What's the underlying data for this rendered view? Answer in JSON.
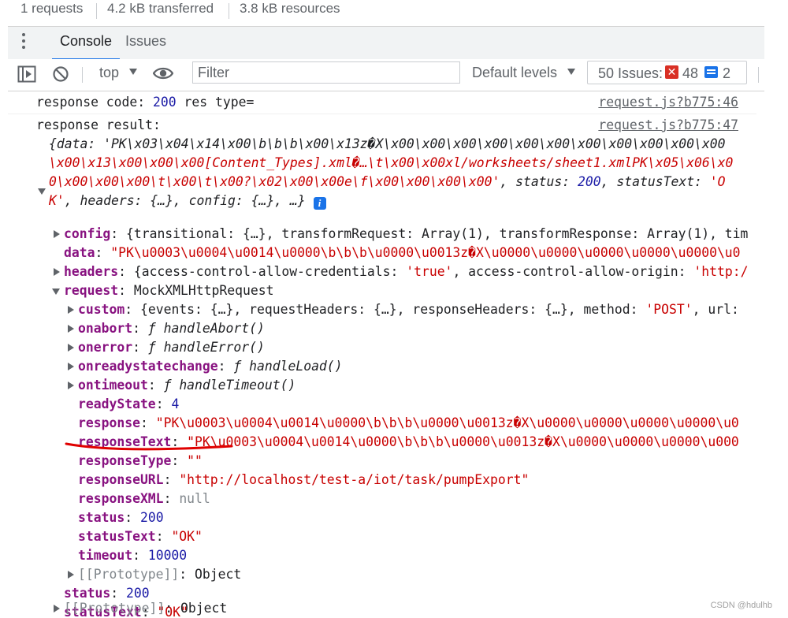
{
  "netbar": {
    "requests": "1 requests",
    "transferred": "4.2 kB transferred",
    "resources": "3.8 kB resources"
  },
  "tabs": {
    "console": "Console",
    "issues": "Issues"
  },
  "toolbar": {
    "context": "top",
    "filter_placeholder": "Filter",
    "levels": "Default levels",
    "issues_label": "50 Issues:",
    "errors_count": "48",
    "info_count": "2"
  },
  "console": {
    "msg1": {
      "text": "response code: ",
      "code": "200",
      "tail": "  res type=",
      "source": "request.js?b775:46"
    },
    "msg2": {
      "text": "response result:",
      "source": "request.js?b775:47",
      "summary_line1": "{data: 'PK\\x03\\x04\\x14\\x00\\b\\b\\b\\x00\\x13z�X\\x00\\x00\\x00\\x00\\x00\\x00\\x00\\x00\\x00\\x00\\x00",
      "summary_line2": "\\x00\\x13\\x00\\x00\\x00[Content_Types].xml�…\\t\\x00\\x00xl/worksheets/sheet1.xmlPK\\x05\\x06\\x0",
      "summary_line3a": "0\\x00\\x00\\x00\\t\\x00\\t\\x00?\\x02\\x00\\x00e\\f\\x00\\x00\\x00\\x00'",
      "summary_line3b": ", status: ",
      "summary_line3c": "200",
      "summary_line3d": ", statusText: ",
      "summary_line3e": "'O",
      "summary_line4a": "K'",
      "summary_line4b": ", headers: {…}, config: {…}, …}",
      "info_badge": "i"
    },
    "config": {
      "key": "config",
      "value": "{transitional: {…}, transformRequest: Array(1), transformResponse: Array(1), tim"
    },
    "data": {
      "key": "data",
      "value": "\"PK\\u0003\\u0004\\u0014\\u0000\\b\\b\\b\\u0000\\u0013z�X\\u0000\\u0000\\u0000\\u0000\\u0000\\u0"
    },
    "headers": {
      "key": "headers",
      "v1": "{access-control-allow-credentials: ",
      "v2": "'true'",
      "v3": ", access-control-allow-origin: ",
      "v4": "'http:/"
    },
    "request": {
      "key": "request",
      "value": "MockXMLHttpRequest"
    },
    "custom": {
      "key": "custom",
      "v1": "{events: {…}, requestHeaders: {…}, responseHeaders: {…}, method: ",
      "v2": "'POST'",
      "v3": ", url:"
    },
    "onabort": {
      "key": "onabort",
      "f": "ƒ ",
      "value": "handleAbort()"
    },
    "onerror": {
      "key": "onerror",
      "f": "ƒ ",
      "value": "handleError()"
    },
    "onreadystatechange": {
      "key": "onreadystatechange",
      "f": "ƒ ",
      "value": "handleLoad()"
    },
    "ontimeout": {
      "key": "ontimeout",
      "f": "ƒ ",
      "value": "handleTimeout()"
    },
    "readyState": {
      "key": "readyState",
      "value": "4"
    },
    "response": {
      "key": "response",
      "value": "\"PK\\u0003\\u0004\\u0014\\u0000\\b\\b\\b\\u0000\\u0013z�X\\u0000\\u0000\\u0000\\u0000\\u0"
    },
    "responseText": {
      "key": "responseText",
      "value": "\"PK\\u0003\\u0004\\u0014\\u0000\\b\\b\\b\\u0000\\u0013z�X\\u0000\\u0000\\u0000\\u000"
    },
    "responseType": {
      "key": "responseType",
      "value": "\"\""
    },
    "responseURL": {
      "key": "responseURL",
      "value": "\"http://localhost/test-a/iot/task/pumpExport\""
    },
    "responseXML": {
      "key": "responseXML",
      "value": "null"
    },
    "status_inner": {
      "key": "status",
      "value": "200"
    },
    "statusText_inner": {
      "key": "statusText",
      "value": "\"OK\""
    },
    "timeout": {
      "key": "timeout",
      "value": "10000"
    },
    "proto_inner": {
      "key": "[[Prototype]]",
      "value": "Object"
    },
    "status_outer": {
      "key": "status",
      "value": "200"
    },
    "statusText_outer": {
      "key": "statusText",
      "value": "\"OK\""
    },
    "proto_outer": {
      "key": "[[Prototype]]",
      "value": "Object"
    }
  },
  "watermark": "CSDN @hdulhb",
  "colors": {
    "key": "#881280",
    "string": "#c80000",
    "number": "#1a1aa6",
    "accent": "#1a73e8",
    "annotation": "#e00000"
  }
}
